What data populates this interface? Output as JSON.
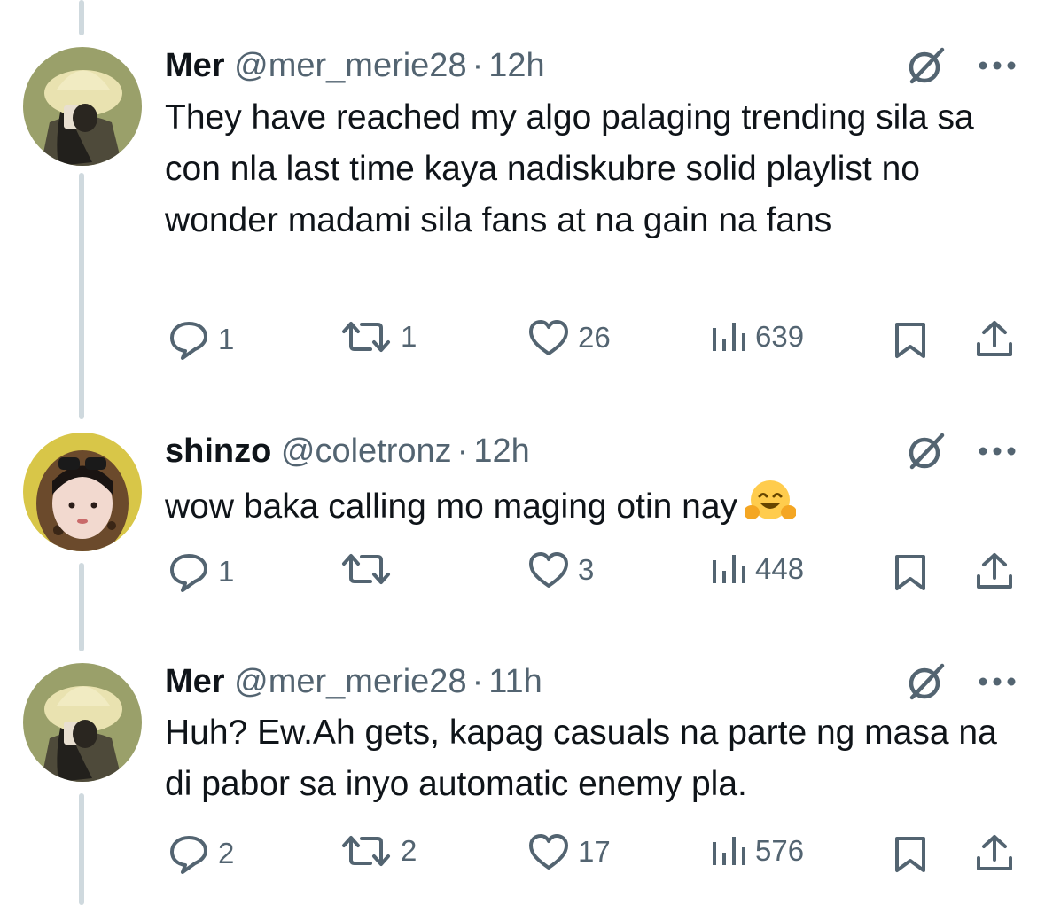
{
  "tweets": [
    {
      "name": "Mer",
      "handle": "@mer_merie28",
      "separator": "·",
      "time": "12h",
      "text": "They have reached my algo palaging trending sila sa con nla last time kaya nadiskubre solid playlist no wonder madami sila fans at na gain na fans",
      "emoji": "",
      "replies": "1",
      "reposts": "1",
      "likes": "26",
      "views": "639"
    },
    {
      "name": "shinzo",
      "handle": "@coletronz",
      "separator": "·",
      "time": "12h",
      "text": "wow baka calling mo maging otin nay",
      "emoji": "hugging-face-emoji",
      "replies": "1",
      "reposts": "",
      "likes": "3",
      "views": "448"
    },
    {
      "name": "Mer",
      "handle": "@mer_merie28",
      "separator": "·",
      "time": "11h",
      "text": "Huh? Ew.Ah gets, kapag casuals na parte ng masa na di pabor sa inyo automatic enemy pla.",
      "emoji": "",
      "replies": "2",
      "reposts": "2",
      "likes": "17",
      "views": "576"
    }
  ],
  "icons": {
    "grok": "grok-slash-icon",
    "more": "more-dots-icon",
    "reply": "reply-bubble-icon",
    "repost": "repost-arrows-icon",
    "like": "heart-icon",
    "views": "views-bars-icon",
    "bookmark": "bookmark-icon",
    "share": "share-upload-icon"
  },
  "colors": {
    "text": "#0f1419",
    "secondary": "#536471",
    "thread_line": "#cfd9de"
  }
}
